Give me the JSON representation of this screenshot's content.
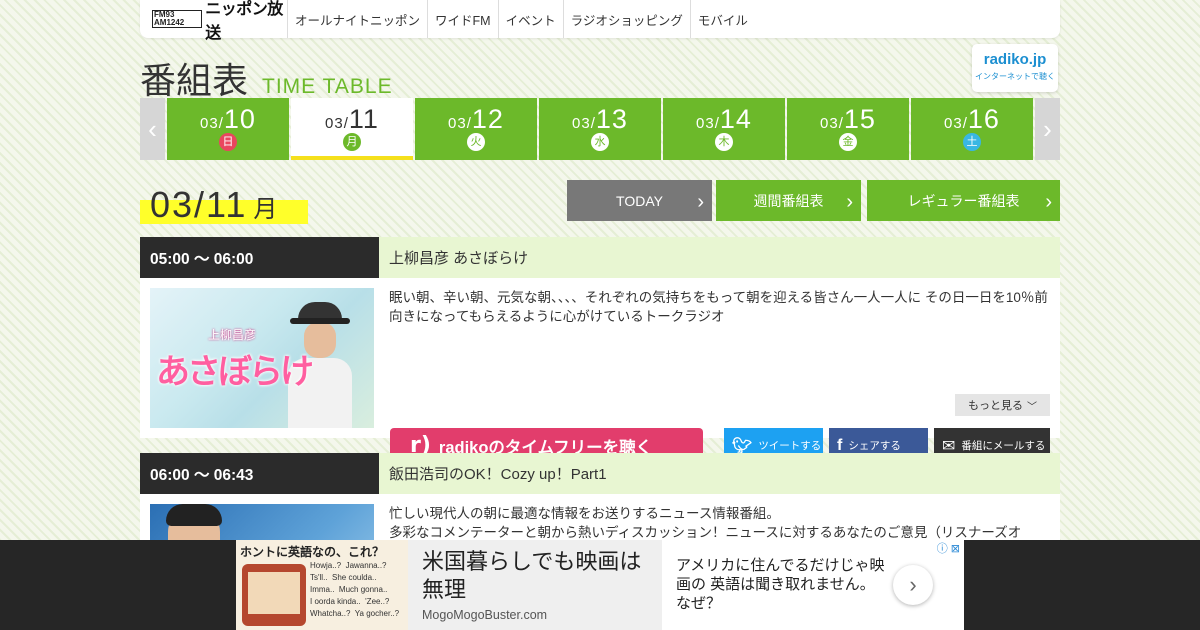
{
  "nav": {
    "logo_mark": "FM93 AM1242",
    "logo_text": "ニッポン放送",
    "items": [
      "オールナイトニッポン",
      "ワイドFM",
      "イベント",
      "ラジオショッピング",
      "モバイル"
    ]
  },
  "header": {
    "title_ja": "番組表",
    "title_en": "TIME TABLE",
    "radiko_line1": "radiko.jp",
    "radiko_line2": "インターネットで聴く"
  },
  "dates": {
    "prev": "‹",
    "next": "›",
    "tabs": [
      {
        "month": "03/",
        "day": "10",
        "dow": "日"
      },
      {
        "month": "03/",
        "day": "11",
        "dow": "月"
      },
      {
        "month": "03/",
        "day": "12",
        "dow": "火"
      },
      {
        "month": "03/",
        "day": "13",
        "dow": "水"
      },
      {
        "month": "03/",
        "day": "14",
        "dow": "木"
      },
      {
        "month": "03/",
        "day": "15",
        "dow": "金"
      },
      {
        "month": "03/",
        "day": "16",
        "dow": "土"
      }
    ],
    "active_index": 1
  },
  "current": {
    "date": "03/11",
    "dow": "月",
    "today_button": "TODAY",
    "weekly_button": "週間番組表",
    "regular_button": "レギュラー番組表"
  },
  "programs": [
    {
      "time": "05:00 ～ 06:00",
      "title": "上柳昌彦 あさぼらけ",
      "thumb_sub": "上柳昌彦",
      "thumb_main": "あさぼらけ",
      "description": "眠い朝、辛い朝、元気な朝、、、、それぞれの気持ちをもって朝を迎える皆さん一人一人に その日一日を10％前向きになってもらえるように心がけているトークラジオ",
      "more": "もっと見る",
      "radiko": "radikoのタイムフリーを聴く",
      "tweet": "ツイートする",
      "share": "シェアする",
      "mail": "番組にメールする"
    },
    {
      "time": "06:00 ～ 06:43",
      "title": "飯田浩司のOK！Cozy up！Part1",
      "description_lines": [
        "忙しい現代人の朝に最適な情報をお送りするニュース情報番組。",
        "多彩なコメンテーターと朝から熱いディスカッション！ニュースに対するあなたのご意見（リスナーズオ"
      ]
    }
  ],
  "ad": {
    "image_caption": "ホントに英語なの、これ？",
    "image_words": [
      "Howja..?",
      "Jawanna..?",
      "Ts'll..",
      "She coulda..",
      "Imma..",
      "Much gonna..",
      "I oorda kinda..",
      "'Zee..?",
      "Whatcha..?",
      "Ya gocher..?"
    ],
    "headline": "米国暮らしでも映画は無理",
    "source": "MogoMogoBuster.com",
    "body": "アメリカに住んでるだけじゃ映画の 英語は聞き取れません。なぜ？",
    "next": "›",
    "close": "ⓘ ⊠"
  },
  "colors": {
    "accent_green": "#6cb92a",
    "highlight_yellow": "#ffff2a",
    "radiko_pink": "#e23d6c",
    "twitter": "#1da1f2",
    "facebook": "#3b5998"
  }
}
